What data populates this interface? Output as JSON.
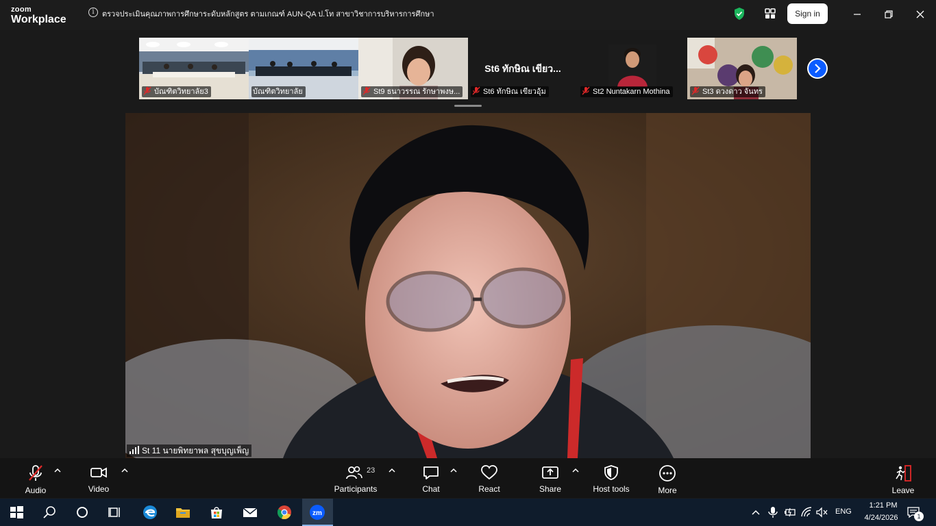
{
  "titlebar": {
    "logo_top": "zoom",
    "logo_bottom": "Workplace",
    "meeting_title": "ตรวจประเมินคุณภาพการศึกษาระดับหลักสูตร ตามเกณฑ์ AUN-QA ป.โท สาขาวิชาการบริหารการศึกษา",
    "signin_label": "Sign in"
  },
  "filmstrip": {
    "tiles": [
      {
        "label": "บัณฑิตวิทยาลัย3",
        "muted": true
      },
      {
        "label": "บัณฑิตวิทยาลัย",
        "muted": false
      },
      {
        "label": "St9 ธนาวรรณ รักษาพงษ...",
        "muted": true
      },
      {
        "label": "St6 ทักษิณ  เขียวอุ้ม",
        "muted": true,
        "big_name": "St6 ทักษิณ  เขียว..."
      },
      {
        "label": "St2 Nuntakarn Mothina",
        "muted": true
      },
      {
        "label": "St3 ดวงดาว จันทร",
        "muted": true
      }
    ]
  },
  "main_video": {
    "speaker_label": "St 11 นายพิทยาพล สุขบุญเพ็ญ"
  },
  "toolbar": {
    "audio": "Audio",
    "video": "Video",
    "participants": "Participants",
    "participants_count": "23",
    "chat": "Chat",
    "react": "React",
    "share": "Share",
    "host_tools": "Host tools",
    "more": "More",
    "leave": "Leave"
  },
  "taskbar": {
    "lang": "ENG",
    "time": "1:21 PM",
    "date": "4/24/2026",
    "notif_count": "1"
  },
  "colors": {
    "accent_blue": "#0b5cff",
    "leave_red": "#e02828",
    "shield_green": "#1bb55c",
    "mute_red": "#e02828"
  }
}
